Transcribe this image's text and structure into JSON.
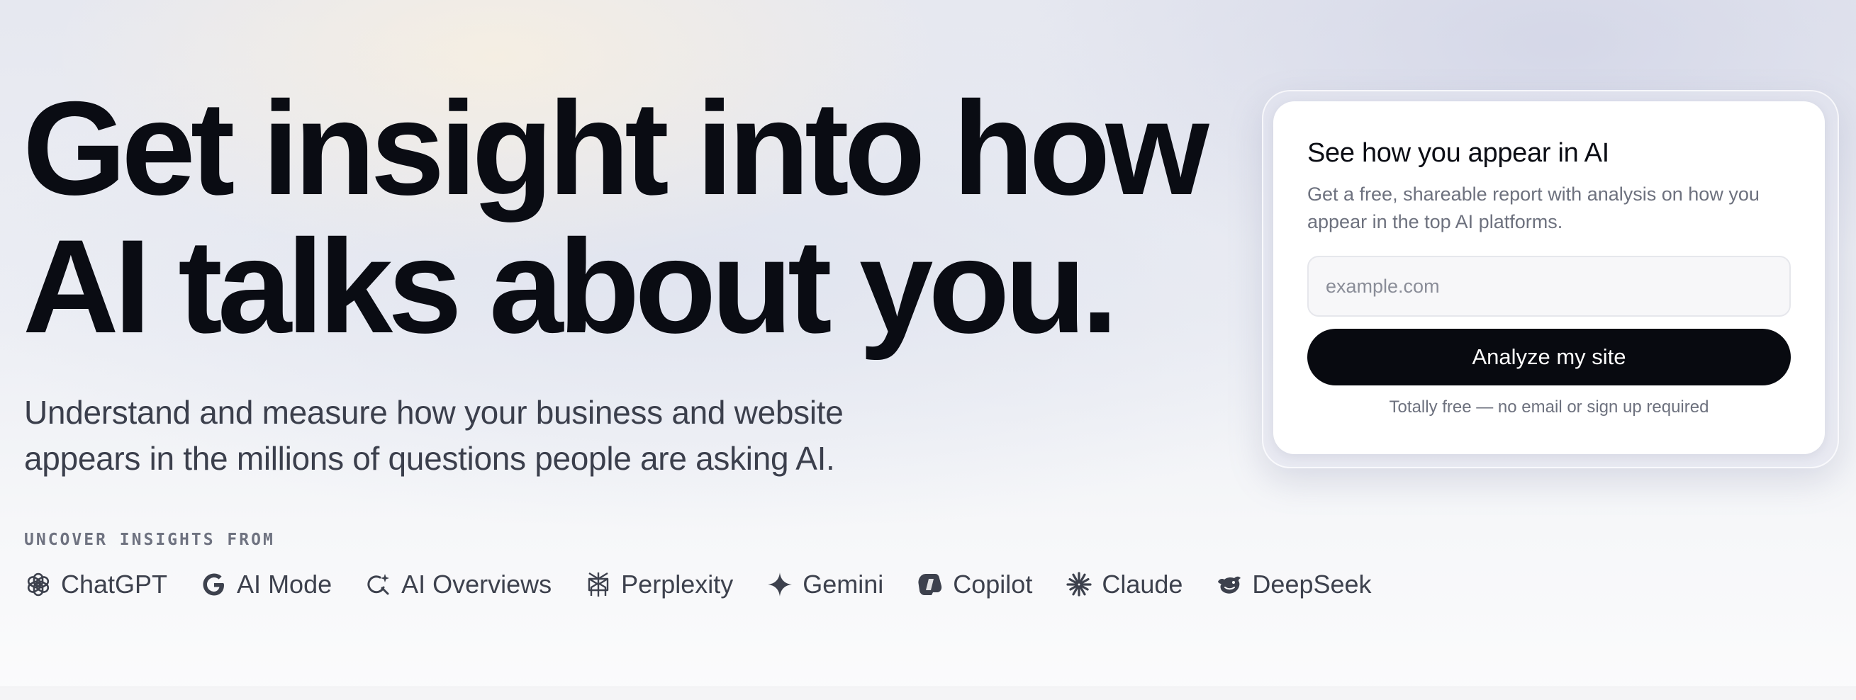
{
  "hero": {
    "title_line1": "Get insight into how",
    "title_line2": "AI talks about you.",
    "subtitle_line1": "Understand and measure how your business and website",
    "subtitle_line2": "appears in the millions of questions people are asking AI."
  },
  "insights": {
    "label": "UNCOVER INSIGHTS FROM",
    "platforms": [
      {
        "name": "ChatGPT",
        "icon": "chatgpt-icon"
      },
      {
        "name": "AI Mode",
        "icon": "google-icon"
      },
      {
        "name": "AI Overviews",
        "icon": "ai-overviews-icon"
      },
      {
        "name": "Perplexity",
        "icon": "perplexity-icon"
      },
      {
        "name": "Gemini",
        "icon": "gemini-icon"
      },
      {
        "name": "Copilot",
        "icon": "copilot-icon"
      },
      {
        "name": "Claude",
        "icon": "claude-icon"
      },
      {
        "name": "DeepSeek",
        "icon": "deepseek-icon"
      }
    ]
  },
  "card": {
    "title": "See how you appear in AI",
    "desc_line1": "Get a free, shareable report with analysis on how you",
    "desc_line2": "appear in the top AI platforms.",
    "input_placeholder": "example.com",
    "input_value": "",
    "button_label": "Analyze my site",
    "note": "Totally free — no email or sign up required"
  },
  "colors": {
    "title": "#0a0c13",
    "button_bg": "#080a10",
    "muted_text": "#6d717e"
  }
}
